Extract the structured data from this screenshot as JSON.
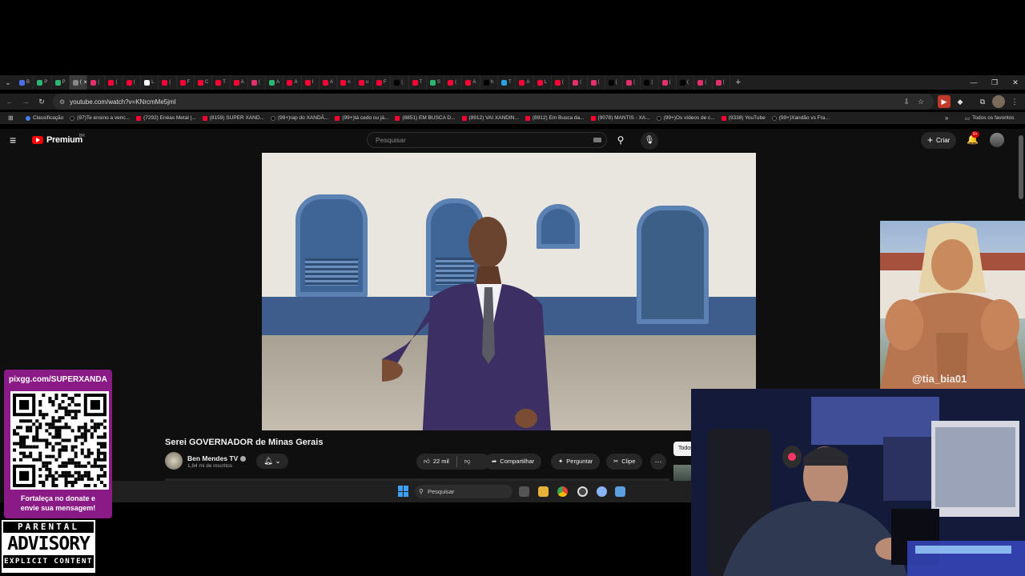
{
  "browser": {
    "tab_letters": [
      "B",
      "P",
      "P",
      "(",
      "(",
      "(",
      "(",
      "L",
      "(",
      "F",
      "C",
      "T",
      "A",
      "(",
      "A",
      "A",
      "I",
      "A",
      "n",
      "u",
      "F",
      "(",
      "T",
      "S",
      "(",
      "A",
      "h",
      "T",
      "A",
      "L",
      "(",
      "(",
      "(",
      "(",
      "(",
      "(",
      "(",
      "(",
      "(",
      "("
    ],
    "url": "youtube.com/watch?v=KNrcmMe5jmI",
    "bookmarks": [
      {
        "label": "Classificação",
        "icon": "chrome-icon"
      },
      {
        "label": "(97)Te ensino a venc...",
        "icon": "tiktok-icon"
      },
      {
        "label": "(7292) Enéas Metal |...",
        "icon": "youtube-icon"
      },
      {
        "label": "(8159) SUPER XAND...",
        "icon": "youtube-icon"
      },
      {
        "label": "(99+)rap do XANDÃ...",
        "icon": "tiktok-icon"
      },
      {
        "label": "(99+)tá cedo ou já...",
        "icon": "youtube-icon"
      },
      {
        "label": "(8851) EM BUSCA D...",
        "icon": "youtube-icon"
      },
      {
        "label": "(8912) VAI XANDIN...",
        "icon": "youtube-icon"
      },
      {
        "label": "(8912) Em Busca da...",
        "icon": "youtube-icon"
      },
      {
        "label": "(9078) MANTIS - XA...",
        "icon": "youtube-icon"
      },
      {
        "label": "(99+)Os vídeos de c...",
        "icon": "tiktok-icon"
      },
      {
        "label": "(9338) YouTube",
        "icon": "youtube-icon"
      },
      {
        "label": "(99+)Xandão vs Fra...",
        "icon": "tiktok-icon"
      }
    ],
    "all_bookmarks_label": "Todos os favoritos"
  },
  "youtube": {
    "brand": "Premium",
    "country_code": "BR",
    "search_placeholder": "Pesquisar",
    "create_label": "Criar",
    "notifications_badge": "9+",
    "video_title": "Serei GOVERNADOR de Minas Gerais",
    "channel_name": "Ben Mendes TV",
    "subscribers": "1,84 mi de inscritos",
    "likes": "22 mil",
    "share_label": "Compartilhar",
    "ask_label": "Perguntar",
    "clip_label": "Clipe",
    "chip_label": "Todos"
  },
  "taskbar": {
    "search_placeholder": "Pesquisar"
  },
  "overlays": {
    "qr_url": "pixgg.com/SUPERXANDA",
    "qr_message_line1": "Fortaleça no donate e",
    "qr_message_line2": "envie sua mensagem!",
    "advisory_line1": "PARENTAL",
    "advisory_line2": "ADVISORY",
    "advisory_line3": "EXPLICIT CONTENT",
    "image_watermark": "@tia_bia01"
  },
  "colors": {
    "youtube_red": "#ff0000",
    "donation_panel": "#8a1a86",
    "facade_blue": "#3f6596"
  }
}
